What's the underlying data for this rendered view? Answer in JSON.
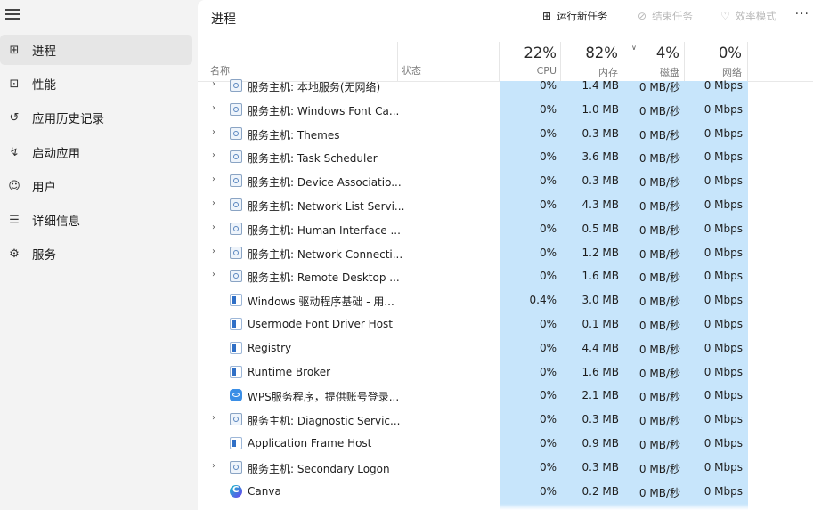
{
  "sidebar": {
    "items": [
      {
        "label": "进程",
        "icon": "processes-icon",
        "active": true
      },
      {
        "label": "性能",
        "icon": "performance-icon"
      },
      {
        "label": "应用历史记录",
        "icon": "history-icon"
      },
      {
        "label": "启动应用",
        "icon": "startup-icon"
      },
      {
        "label": "用户",
        "icon": "users-icon"
      },
      {
        "label": "详细信息",
        "icon": "details-icon"
      },
      {
        "label": "服务",
        "icon": "services-icon"
      }
    ]
  },
  "header": {
    "title": "进程",
    "run_task": "运行新任务",
    "end_task": "结束任务",
    "efficiency": "效率模式",
    "more": "···"
  },
  "columns": {
    "name": "名称",
    "status": "状态",
    "cpu": {
      "pct": "22%",
      "label": "CPU"
    },
    "memory": {
      "pct": "82%",
      "label": "内存"
    },
    "disk": {
      "pct": "4%",
      "label": "磁盘"
    },
    "network": {
      "pct": "0%",
      "label": "网络"
    }
  },
  "processes": [
    {
      "name": "服务主机: 本地服务(无网络)",
      "type": "svc",
      "expandable": true,
      "cpu": "0%",
      "mem": "1.4 MB",
      "disk": "0 MB/秒",
      "net": "0 Mbps"
    },
    {
      "name": "服务主机: Windows Font Ca...",
      "type": "svc",
      "expandable": true,
      "cpu": "0%",
      "mem": "1.0 MB",
      "disk": "0 MB/秒",
      "net": "0 Mbps"
    },
    {
      "name": "服务主机: Themes",
      "type": "svc",
      "expandable": true,
      "cpu": "0%",
      "mem": "0.3 MB",
      "disk": "0 MB/秒",
      "net": "0 Mbps"
    },
    {
      "name": "服务主机: Task Scheduler",
      "type": "svc",
      "expandable": true,
      "cpu": "0%",
      "mem": "3.6 MB",
      "disk": "0 MB/秒",
      "net": "0 Mbps"
    },
    {
      "name": "服务主机: Device Associatio...",
      "type": "svc",
      "expandable": true,
      "cpu": "0%",
      "mem": "0.3 MB",
      "disk": "0 MB/秒",
      "net": "0 Mbps"
    },
    {
      "name": "服务主机: Network List Servi...",
      "type": "svc",
      "expandable": true,
      "cpu": "0%",
      "mem": "4.3 MB",
      "disk": "0 MB/秒",
      "net": "0 Mbps"
    },
    {
      "name": "服务主机: Human Interface ...",
      "type": "svc",
      "expandable": true,
      "cpu": "0%",
      "mem": "0.5 MB",
      "disk": "0 MB/秒",
      "net": "0 Mbps"
    },
    {
      "name": "服务主机: Network Connecti...",
      "type": "svc",
      "expandable": true,
      "cpu": "0%",
      "mem": "1.2 MB",
      "disk": "0 MB/秒",
      "net": "0 Mbps"
    },
    {
      "name": "服务主机: Remote Desktop ...",
      "type": "svc",
      "expandable": true,
      "cpu": "0%",
      "mem": "1.6 MB",
      "disk": "0 MB/秒",
      "net": "0 Mbps"
    },
    {
      "name": "Windows 驱动程序基础 - 用...",
      "type": "win",
      "expandable": false,
      "cpu": "0.4%",
      "mem": "3.0 MB",
      "disk": "0 MB/秒",
      "net": "0 Mbps"
    },
    {
      "name": "Usermode Font Driver Host",
      "type": "win",
      "expandable": false,
      "cpu": "0%",
      "mem": "0.1 MB",
      "disk": "0 MB/秒",
      "net": "0 Mbps"
    },
    {
      "name": "Registry",
      "type": "win",
      "expandable": false,
      "cpu": "0%",
      "mem": "4.4 MB",
      "disk": "0 MB/秒",
      "net": "0 Mbps"
    },
    {
      "name": "Runtime Broker",
      "type": "win",
      "expandable": false,
      "cpu": "0%",
      "mem": "1.6 MB",
      "disk": "0 MB/秒",
      "net": "0 Mbps"
    },
    {
      "name": "WPS服务程序，提供账号登录...",
      "type": "wps",
      "expandable": false,
      "cpu": "0%",
      "mem": "2.1 MB",
      "disk": "0 MB/秒",
      "net": "0 Mbps"
    },
    {
      "name": "服务主机: Diagnostic Servic...",
      "type": "svc",
      "expandable": true,
      "cpu": "0%",
      "mem": "0.3 MB",
      "disk": "0 MB/秒",
      "net": "0 Mbps"
    },
    {
      "name": "Application Frame Host",
      "type": "win",
      "expandable": false,
      "cpu": "0%",
      "mem": "0.9 MB",
      "disk": "0 MB/秒",
      "net": "0 Mbps"
    },
    {
      "name": "服务主机: Secondary Logon",
      "type": "svc",
      "expandable": true,
      "cpu": "0%",
      "mem": "0.3 MB",
      "disk": "0 MB/秒",
      "net": "0 Mbps"
    },
    {
      "name": "Canva",
      "type": "canva",
      "expandable": false,
      "cpu": "0%",
      "mem": "0.2 MB",
      "disk": "0 MB/秒",
      "net": "0 Mbps"
    }
  ]
}
